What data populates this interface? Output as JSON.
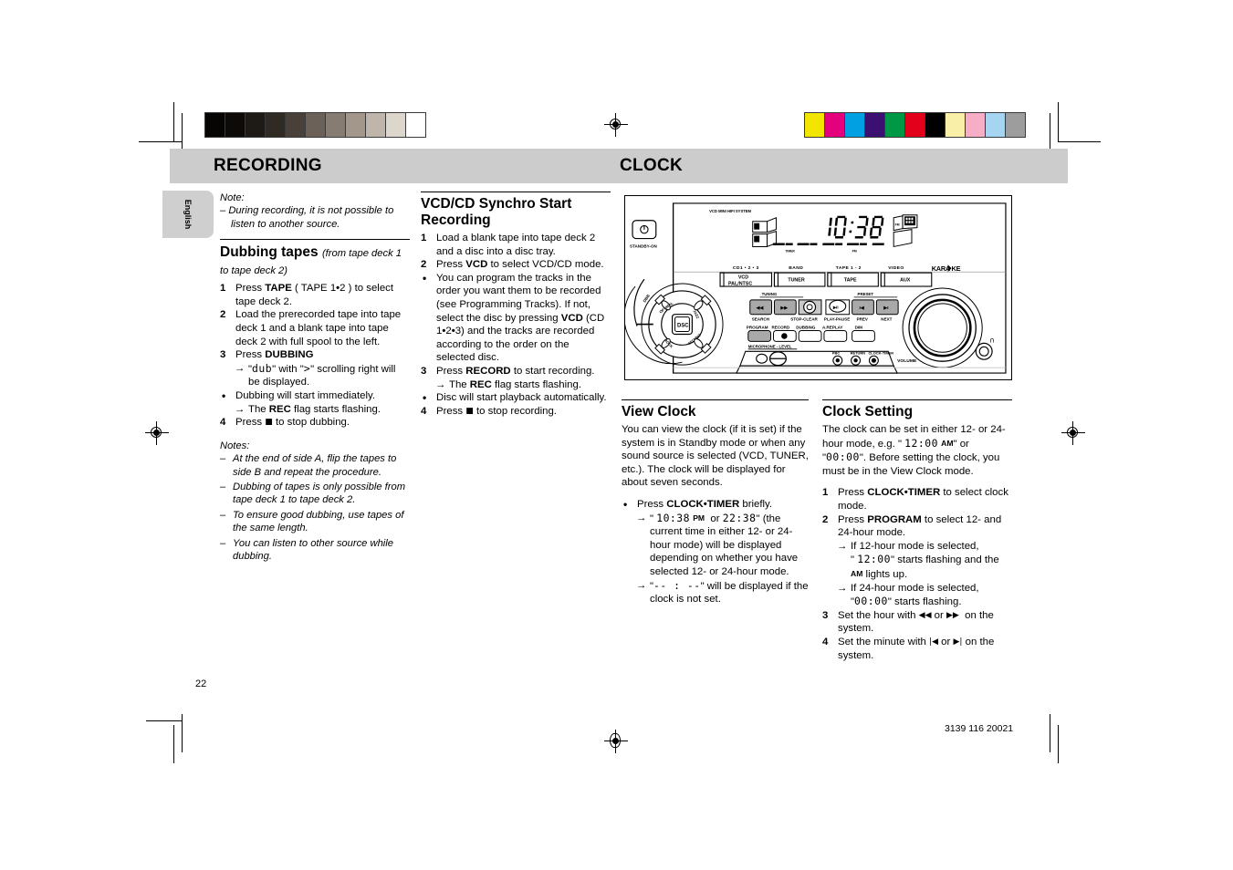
{
  "page": {
    "number": "22",
    "doc_code": "3139 116 20021",
    "language_tab": "English"
  },
  "header": {
    "left_title": "RECORDING",
    "right_title": "CLOCK"
  },
  "recording": {
    "note_label": "Note:",
    "note_items": [
      "– During recording, it is not possible to listen to another source."
    ],
    "dubbing": {
      "heading": "Dubbing tapes",
      "heading_sub": "(from tape deck 1 to tape deck 2)",
      "steps": [
        {
          "mark": "1",
          "text": "Press TAPE ( TAPE 1•2 ) to select tape deck 2."
        },
        {
          "mark": "2",
          "text": "Load the prerecorded tape into tape deck 1 and a blank tape into tape deck 2 with full spool to the left."
        },
        {
          "mark": "3",
          "text": "Press DUBBING"
        },
        {
          "mark": "→",
          "text": "\"dub\" with \">\" scrolling right will be displayed."
        },
        {
          "mark": "•",
          "text": "Dubbing will start immediately."
        },
        {
          "mark": "→",
          "text": "The REC flag starts flashing."
        },
        {
          "mark": "4",
          "text": "Press ■ to stop dubbing."
        }
      ],
      "notes_label": "Notes:",
      "notes": [
        "– At the end of side A, flip the tapes to side B and repeat the procedure.",
        "– Dubbing of tapes is only possible from tape deck 1 to tape deck 2.",
        "– To ensure good dubbing, use tapes of the same length.",
        "– You can listen to other source while dubbing."
      ]
    },
    "synchro": {
      "heading_line1": "VCD/CD Synchro Start",
      "heading_line2": "Recording",
      "steps": [
        {
          "mark": "1",
          "text": "Load a blank tape into tape deck 2 and a disc into a disc tray."
        },
        {
          "mark": "2",
          "text": "Press VCD to select VCD/CD mode."
        },
        {
          "mark": "•",
          "text": "You can program the tracks in the order you want them to be recorded (see Programming Tracks). If not,  select the disc by pressing VCD (CD 1•2•3) and the tracks are recorded according to the order on the selected disc."
        },
        {
          "mark": "3",
          "text": "Press RECORD to start recording."
        },
        {
          "mark": "→",
          "text": "The REC flag starts flashing."
        },
        {
          "mark": "•",
          "text": "Disc will start playback automatically."
        },
        {
          "mark": "4",
          "text": "Press ■ to stop recording."
        }
      ]
    }
  },
  "clock": {
    "view_clock": {
      "heading": "View Clock",
      "intro": "You can view the clock (if it is set) if the system is in Standby mode or when any sound source is selected (VCD, TUNER, etc.).  The clock will be displayed for about seven seconds.",
      "steps": [
        {
          "mark": "•",
          "text": "Press CLOCK•TIMER briefly."
        },
        {
          "mark": "→",
          "text": "\" 10:38 PM  or 22:38\" (the current time in either 12- or 24-hour mode) will be displayed depending on whether you have selected 12- or 24-hour mode."
        },
        {
          "mark": "→",
          "text": "\"--:--\" will be displayed if the clock is not set."
        }
      ]
    },
    "clock_setting": {
      "heading": "Clock Setting",
      "intro": "The clock can be set in either 12- or 24-hour mode, e.g. \" 12:00 AM\" or \"00:00\". Before setting the clock, you must be in the View Clock mode.",
      "steps": [
        {
          "mark": "1",
          "text": "Press CLOCK•TIMER to select clock mode."
        },
        {
          "mark": "2",
          "text": "Press PROGRAM to select 12- and 24-hour mode."
        },
        {
          "mark": "→",
          "text": "If 12-hour mode is selected, \" 12:00\" starts flashing and the AM lights up."
        },
        {
          "mark": "→",
          "text": "If 24-hour mode is selected, \"00:00\" starts flashing."
        },
        {
          "mark": "3",
          "text": "Set the hour with ◀◀ or ▶▶  on the system."
        },
        {
          "mark": "4",
          "text": "Set the minute with |◀ or ▶| on the system."
        }
      ]
    }
  },
  "diagram": {
    "model_label": "VCD MINI HIFI SYSTEM",
    "standby_label": "STANDBY-ON",
    "display": {
      "time": "10:38",
      "pm_label": "PM",
      "timer_label": "TIMER",
      "pgm_label": "PGM",
      "rep_label": "REP"
    },
    "karaoke_logo": "KARAOKE",
    "source_top_labels": [
      "CD1 • 2 • 3",
      "BAND",
      "TAPE 1 - 2",
      "VIDEO"
    ],
    "source_buttons": [
      {
        "line1": "VCD",
        "line2": "PAL/NTSC"
      },
      {
        "line1": "TUNER",
        "line2": ""
      },
      {
        "line1": "TAPE",
        "line2": ""
      },
      {
        "line1": "AUX",
        "line2": ""
      }
    ],
    "transport_group_labels": {
      "left": "TUNING",
      "right": "PRESET"
    },
    "transport_labels": [
      "SEARCH",
      "STOP-CLEAR",
      "PLAY-PAUSE",
      "PREV",
      "NEXT"
    ],
    "function_buttons": [
      "PROGRAM",
      "RECORD",
      "DUBBING",
      "A.REPLAY",
      "DIM"
    ],
    "mic_label": "MICROPHONE - LEVEL",
    "jack_labels": [
      "PBC",
      "RETURN",
      "CLOCK-TIMER"
    ],
    "volume_label": "VOLUME",
    "dsc_label": "DSC",
    "dsc_modes": [
      "OPTIMAL",
      "JAZZ",
      "TECHNO",
      "ROCK"
    ],
    "dbb_label": "DBB"
  },
  "colorbars": {
    "grayscale": [
      "#070503",
      "#0e0a07",
      "#1e1a16",
      "#2f2a24",
      "#484039",
      "#6b6158",
      "#877c72",
      "#a3978c",
      "#c0b5aa",
      "#ddd6cc",
      "#ffffff"
    ],
    "chroma": [
      "#f2e500",
      "#e5007e",
      "#00a0e3",
      "#3b1070",
      "#009844",
      "#e3001b",
      "#000000",
      "#f9efa9",
      "#f6adc6",
      "#a6d5f2",
      "#9d9d9d"
    ]
  }
}
